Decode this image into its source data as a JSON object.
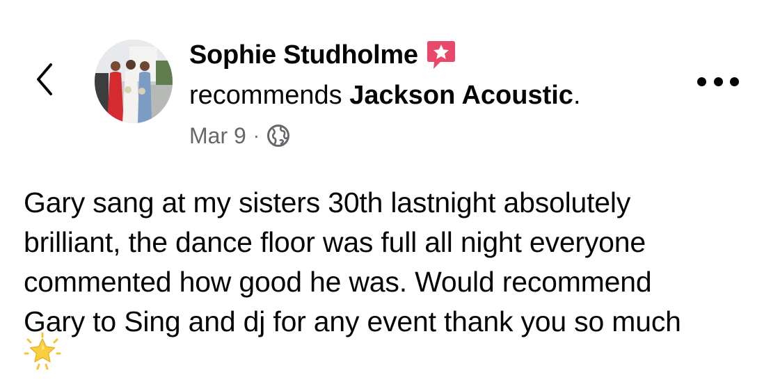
{
  "post": {
    "author": "Sophie Studholme",
    "action_prefix": "recommends ",
    "page_name": "Jackson Acoustic",
    "action_suffix": ".",
    "date": "Mar 9",
    "separator": "·",
    "audience_icon": "globe-icon",
    "badge_icon": "star-badge-icon",
    "body_lines": [
      "Gary sang at my sisters 30th lastnight absolutely",
      "brilliant, the dance floor was full all night everyone",
      "commented how good he was. Would recommend",
      "Gary to Sing and dj for any event thank you so much"
    ],
    "trailing_emoji": "glowing-star-emoji"
  },
  "header": {
    "back_icon": "chevron-left-icon",
    "more_icon": "more-options-icon"
  },
  "colors": {
    "text": "#050505",
    "secondary_text": "#65676b",
    "badge": "#e8496a",
    "star_emoji": "#f7c531"
  }
}
